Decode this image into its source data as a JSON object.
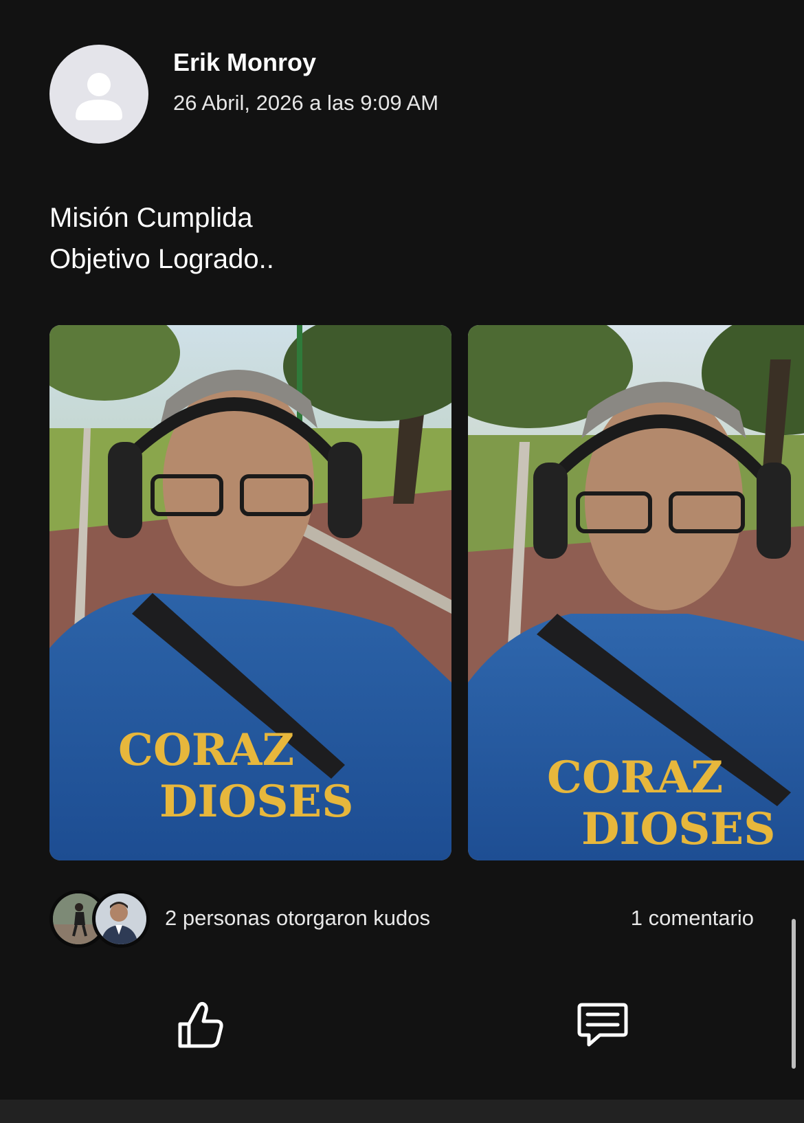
{
  "post": {
    "author": "Erik Monroy",
    "date": "26 Abril, 2026 a las 9:09 AM",
    "text_lines": [
      "Misión Cumplida",
      "Objetivo Logrado.."
    ]
  },
  "photos": [
    {
      "description_icon": "photo-selfie-runner"
    },
    {
      "description_icon": "photo-selfie-runner"
    }
  ],
  "engagement": {
    "kudos_text": "2 personas otorgaron kudos",
    "comments_text": "1 comentario"
  },
  "icons": {
    "avatar": "person-icon",
    "kudos": "thumbs-up-icon",
    "comment": "comment-icon"
  },
  "colors": {
    "background": "#121212",
    "avatar_bg": "#e4e4ea",
    "text": "#ffffff"
  }
}
